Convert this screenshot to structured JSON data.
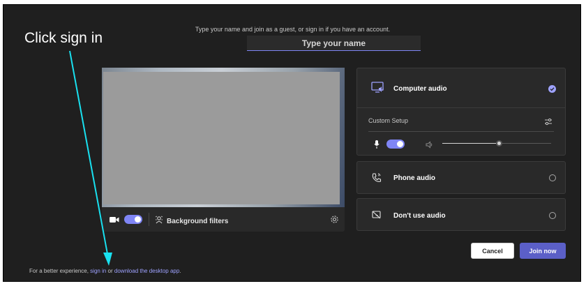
{
  "annotation": {
    "text": "Click sign in"
  },
  "join": {
    "instruction": "Type your name and join as a guest, or sign in if you have an account.",
    "name_placeholder": "Type your name"
  },
  "video": {
    "camera_on": true,
    "background_filters_label": "Background filters"
  },
  "audio": {
    "computer_audio_label": "Computer audio",
    "custom_setup_label": "Custom Setup",
    "mic_on": true,
    "speaker_volume_percent": 52,
    "phone_audio_label": "Phone audio",
    "no_audio_label": "Don't use audio",
    "selected": "computer-audio"
  },
  "actions": {
    "cancel_label": "Cancel",
    "join_label": "Join now"
  },
  "footer": {
    "prefix": "For a better experience,",
    "sign_in_link": "sign in",
    "or_text": "or",
    "download_link": "download the desktop app",
    "suffix": "."
  },
  "colors": {
    "accent": "#7f85f5",
    "primary_button": "#5b5fc7",
    "link": "#9ea2ff",
    "annotation_arrow": "#19e1f0"
  }
}
